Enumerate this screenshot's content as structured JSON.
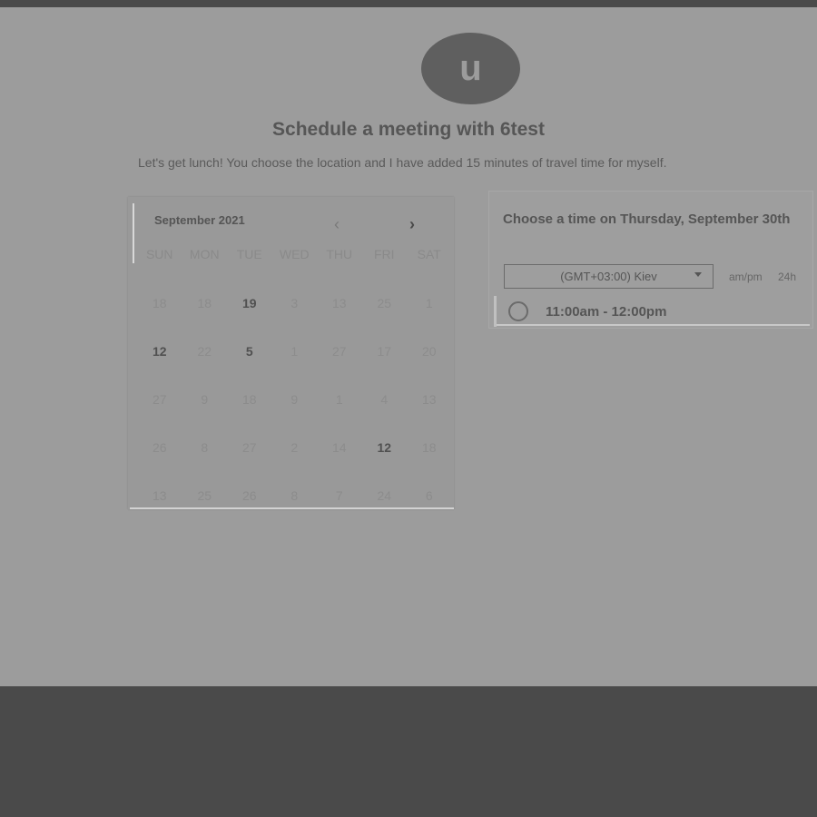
{
  "avatar": {
    "initial": "u"
  },
  "header": {
    "title": "Schedule a meeting with 6test",
    "description": "Let's get lunch! You choose the location and I have added 15 minutes of travel time for myself."
  },
  "calendar": {
    "month_label": "September 2021",
    "prev_icon": "chevron-left-icon",
    "next_icon": "chevron-right-icon",
    "prev_symbol": "‹",
    "next_symbol": "›",
    "weekdays": [
      "SUN",
      "MON",
      "TUE",
      "WED",
      "THU",
      "FRI",
      "SAT"
    ],
    "days": [
      {
        "label": "18",
        "available": false
      },
      {
        "label": "18",
        "available": false
      },
      {
        "label": "19",
        "available": true
      },
      {
        "label": "3",
        "available": false
      },
      {
        "label": "13",
        "available": false
      },
      {
        "label": "25",
        "available": false
      },
      {
        "label": "1",
        "available": false
      },
      {
        "label": "12",
        "available": true
      },
      {
        "label": "22",
        "available": false
      },
      {
        "label": "5",
        "available": true
      },
      {
        "label": "1",
        "available": false
      },
      {
        "label": "27",
        "available": false
      },
      {
        "label": "17",
        "available": false
      },
      {
        "label": "20",
        "available": false
      },
      {
        "label": "27",
        "available": false
      },
      {
        "label": "9",
        "available": false
      },
      {
        "label": "18",
        "available": false
      },
      {
        "label": "9",
        "available": false
      },
      {
        "label": "1",
        "available": false
      },
      {
        "label": "4",
        "available": false
      },
      {
        "label": "13",
        "available": false
      },
      {
        "label": "26",
        "available": false
      },
      {
        "label": "8",
        "available": false
      },
      {
        "label": "27",
        "available": false
      },
      {
        "label": "2",
        "available": false
      },
      {
        "label": "14",
        "available": false
      },
      {
        "label": "12",
        "available": true
      },
      {
        "label": "18",
        "available": false
      },
      {
        "label": "13",
        "available": false
      },
      {
        "label": "25",
        "available": false
      },
      {
        "label": "26",
        "available": false
      },
      {
        "label": "8",
        "available": false
      },
      {
        "label": "7",
        "available": false
      },
      {
        "label": "24",
        "available": false
      },
      {
        "label": "6",
        "available": false
      }
    ]
  },
  "time_panel": {
    "heading": "Choose a time on Thursday, September 30th",
    "timezone": "(GMT+03:00) Kiev",
    "format_ampm": "am/pm",
    "format_24h": "24h",
    "slots": [
      {
        "label": "11:00am - 12:00pm"
      }
    ]
  }
}
